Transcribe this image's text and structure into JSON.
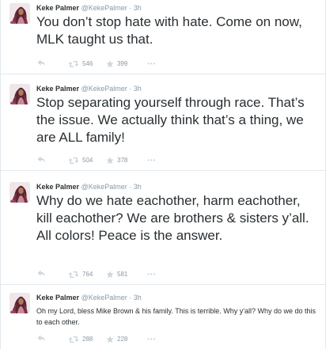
{
  "icons": {
    "avatar": "avatar-photo",
    "reply": "reply-icon",
    "retweet": "retweet-icon",
    "favorite": "star-icon",
    "more": "more-icon"
  },
  "colors": {
    "text": "#292f33",
    "meta": "#8899a6",
    "icon": "#ccd6dd",
    "divider": "#e1e8ed"
  },
  "tweets": [
    {
      "name": "Keke Palmer",
      "handle": "@KekePalmer",
      "dot": "·",
      "time": "3h",
      "text": "You don’t stop hate with hate. Come on now, MLK taught us that.",
      "retweets": "546",
      "favorites": "399",
      "more": "•••"
    },
    {
      "name": "Keke Palmer",
      "handle": "@KekePalmer",
      "dot": "·",
      "time": "3h",
      "text": "Stop separating yourself through race. That’s the issue. We actually think that’s a thing, we are ALL family!",
      "retweets": "504",
      "favorites": "378",
      "more": "•••"
    },
    {
      "name": "Keke Palmer",
      "handle": "@KekePalmer",
      "dot": "·",
      "time": "3h",
      "text": "Why do we hate eachother, harm eachother, kill eachother? We are brothers & sisters y’all. All colors! Peace is the answer.",
      "retweets": "764",
      "favorites": "581",
      "more": "•••"
    },
    {
      "name": "Keke Palmer",
      "handle": "@KekePalmer",
      "dot": "·",
      "time": "3h",
      "text": "Oh my Lord, bless Mike Brown & his family. This is terrible. Why y'all? Why do we do this to each other.",
      "retweets": "288",
      "favorites": "228",
      "more": "•••"
    }
  ]
}
